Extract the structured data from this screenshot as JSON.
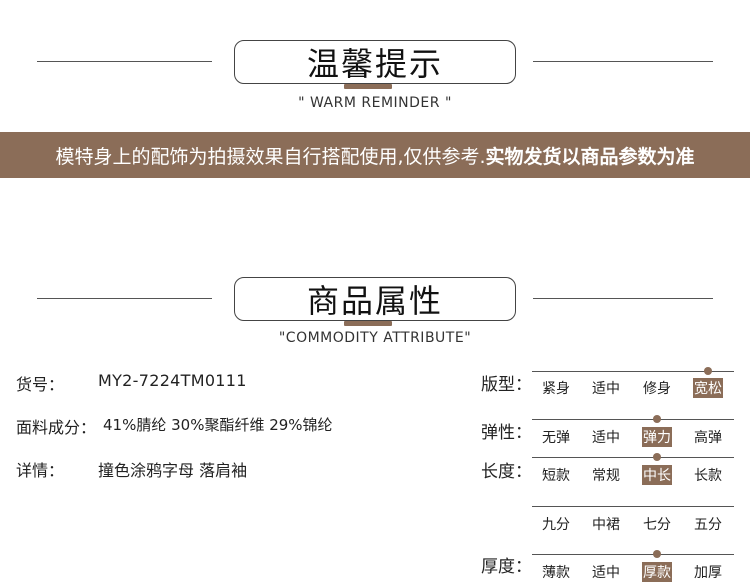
{
  "reminder": {
    "title": "温馨提示",
    "subtitle": "\" WARM REMINDER \"",
    "banner_normal": "模特身上的配饰为拍摄效果自行搭配使用,仅供参考.",
    "banner_bold": "实物发货以商品参数为准"
  },
  "attributes": {
    "title": "商品属性",
    "subtitle": "\"COMMODITY ATTRIBUTE\"",
    "item_no_label": "货号：",
    "item_no_value": "MY2-7224TM0111",
    "fabric_label": "面料成分：",
    "fabric_value": "41%腈纶 30%聚酯纤维 29%锦纶",
    "detail_label": "详情：",
    "detail_value": "撞色涂鸦字母 落肩袖"
  },
  "scales": {
    "fit": {
      "label": "版型：",
      "options": [
        "紧身",
        "适中",
        "修身",
        "宽松"
      ],
      "selected": 3
    },
    "elasticity": {
      "label": "弹性：",
      "options": [
        "无弹",
        "适中",
        "弹力",
        "高弹"
      ],
      "selected": 2
    },
    "length": {
      "label": "长度：",
      "options": [
        "短款",
        "常规",
        "中长",
        "长款"
      ],
      "selected": 2
    },
    "sleeve": {
      "options": [
        "九分",
        "中裙",
        "七分",
        "五分"
      ]
    },
    "thickness": {
      "label": "厚度：",
      "options": [
        "薄款",
        "适中",
        "厚款",
        "加厚"
      ],
      "selected": 2
    }
  },
  "colors": {
    "accent": "#8b6d58"
  }
}
